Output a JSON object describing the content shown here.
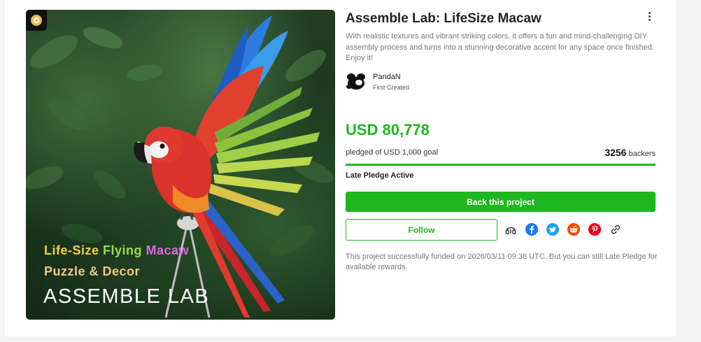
{
  "hero": {
    "line1_part1": "Life-Size ",
    "line1_part2": "Flying ",
    "line1_part3": "Macaw",
    "line2": "Puzzle & Decor",
    "line3": "ASSEMBLE LAB"
  },
  "project": {
    "title": "Assemble Lab: LifeSize Macaw",
    "description": "With realistic textures and vibrant striking colors, it offers a fun and mind-challenging DIY assembly process and turns into a stunning decorative accent for any space once finished. Enjoy it!"
  },
  "creator": {
    "name": "PandaN",
    "role": "First Created"
  },
  "funding": {
    "amount": "USD 80,778",
    "goal_text": "pledged of USD 1,000 goal",
    "backers_count": "3256",
    "backers_label": "backers",
    "progress_fraction": 1.0,
    "status": "Late Pledge Active"
  },
  "actions": {
    "back_label": "Back this project",
    "follow_label": "Follow"
  },
  "share_icons": [
    "headphones-icon",
    "facebook-icon",
    "twitter-icon",
    "reddit-icon",
    "pinterest-icon",
    "link-icon"
  ],
  "note": "This project successfully funded on 2026/03/11 09:38 UTC. But you can still Late Pledge for available rewards.",
  "colors": {
    "accent": "#1fb620",
    "facebook": "#1877f2",
    "twitter": "#1da1f2",
    "reddit": "#ff4500",
    "pinterest": "#e60023"
  }
}
